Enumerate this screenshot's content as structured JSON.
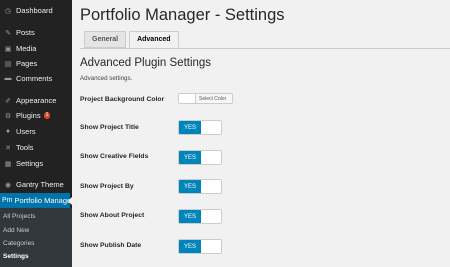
{
  "sidebar": {
    "items": [
      {
        "label": "Dashboard",
        "icon": "dashboard-icon",
        "glyph": "◷"
      },
      {
        "label": "Posts",
        "icon": "pin-icon",
        "glyph": "✎"
      },
      {
        "label": "Media",
        "icon": "media-icon",
        "glyph": "▣"
      },
      {
        "label": "Pages",
        "icon": "page-icon",
        "glyph": "▤"
      },
      {
        "label": "Comments",
        "icon": "comment-icon",
        "glyph": "▬"
      },
      {
        "label": "Appearance",
        "icon": "brush-icon",
        "glyph": "✐"
      },
      {
        "label": "Plugins",
        "icon": "plugin-icon",
        "glyph": "⚙",
        "badge": "1"
      },
      {
        "label": "Users",
        "icon": "user-icon",
        "glyph": "●"
      },
      {
        "label": "Tools",
        "icon": "wrench-icon",
        "glyph": "✕"
      },
      {
        "label": "Settings",
        "icon": "settings-icon",
        "glyph": "▦"
      },
      {
        "label": "Gantry Theme",
        "icon": "gantry-icon",
        "glyph": "◉"
      },
      {
        "label": "Portfolio Manager",
        "icon": "portfolio-icon",
        "glyph": "Pm",
        "active": true
      }
    ],
    "submenu": [
      "All Projects",
      "Add New",
      "Categories",
      "Settings"
    ],
    "submenu_current": "Settings"
  },
  "header": {
    "title": "Portfolio Manager - Settings"
  },
  "tabs": [
    {
      "label": "General",
      "active": false
    },
    {
      "label": "Advanced",
      "active": true
    }
  ],
  "section": {
    "title": "Advanced Plugin Settings",
    "description": "Advanced settings."
  },
  "fields": {
    "background_color": {
      "label": "Project Background Color",
      "button_label": "Select Color",
      "value": "#ffffff"
    },
    "toggles": [
      {
        "label": "Show Project Title",
        "value": "YES"
      },
      {
        "label": "Show Creative Fields",
        "value": "YES"
      },
      {
        "label": "Show Project By",
        "value": "YES"
      },
      {
        "label": "Show About Project",
        "value": "YES"
      },
      {
        "label": "Show Publish Date",
        "value": "YES"
      }
    ]
  },
  "colors": {
    "sidebar": "#222222",
    "active": "#0073aa",
    "toggle_on": "#0085ba",
    "badge": "#d54e21",
    "background": "#f1f1f1"
  }
}
